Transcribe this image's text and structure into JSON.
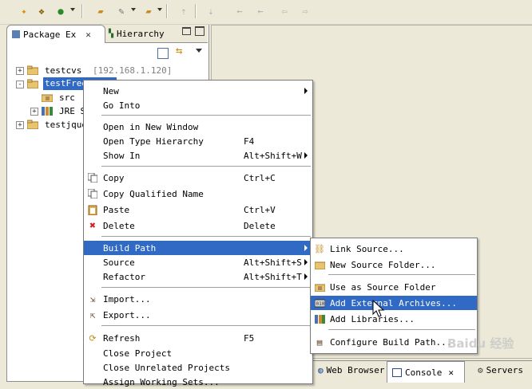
{
  "toolbar": {
    "icons": [
      "new-wizard-icon",
      "new-package-icon",
      "run-icon",
      "open-folder-icon",
      "build-tool-icon",
      "open-project-icon",
      "disabled-nav-icon",
      "disabled-nav-icon-2",
      "back-icon",
      "forward-icon",
      "back-history-icon",
      "forward-history-icon"
    ]
  },
  "package_explorer": {
    "tabs": [
      {
        "label": "Package Ex",
        "icon": "package-icon"
      },
      {
        "label": "Hierarchy",
        "icon": "hierarchy-icon"
      }
    ],
    "tree": [
      {
        "label": "testcvs",
        "extra": "[192.168.1.120]",
        "expander": "+"
      },
      {
        "label": "testFree",
        "expander": "-",
        "selected": true
      },
      {
        "label": "src"
      },
      {
        "label": "JRE S",
        "expander": "+"
      },
      {
        "label": "testjque",
        "expander": "+"
      }
    ]
  },
  "context_menu": {
    "items": [
      {
        "label": "New",
        "submenu": true
      },
      {
        "label": "Go Into"
      },
      {
        "label": "Open in New Window"
      },
      {
        "label": "Open Type Hierarchy",
        "shortcut": "F4"
      },
      {
        "label": "Show In",
        "shortcut": "Alt+Shift+W",
        "submenu": true
      },
      {
        "label": "Copy",
        "shortcut": "Ctrl+C"
      },
      {
        "label": "Copy Qualified Name"
      },
      {
        "label": "Paste",
        "shortcut": "Ctrl+V"
      },
      {
        "label": "Delete",
        "shortcut": "Delete"
      },
      {
        "label": "Build Path",
        "submenu": true,
        "selected": true
      },
      {
        "label": "Source",
        "shortcut": "Alt+Shift+S",
        "submenu": true
      },
      {
        "label": "Refactor",
        "shortcut": "Alt+Shift+T",
        "submenu": true
      },
      {
        "label": "Import..."
      },
      {
        "label": "Export..."
      },
      {
        "label": "Refresh",
        "shortcut": "F5"
      },
      {
        "label": "Close Project"
      },
      {
        "label": "Close Unrelated Projects"
      },
      {
        "label": "Assign Working Sets..."
      }
    ]
  },
  "build_path_submenu": {
    "items": [
      {
        "label": "Link Source..."
      },
      {
        "label": "New Source Folder..."
      },
      {
        "label": "Use as Source Folder"
      },
      {
        "label": "Add External Archives...",
        "selected": true
      },
      {
        "label": "Add Libraries..."
      },
      {
        "label": "Configure Build Path..."
      }
    ]
  },
  "bottom_tabs": [
    {
      "label": "Web Browser",
      "icon": "globe-icon"
    },
    {
      "label": "Console",
      "icon": "console-icon",
      "closable": true
    },
    {
      "label": "Servers",
      "icon": "servers-icon"
    }
  ],
  "watermark": "Baidu 经验",
  "colors": {
    "selection": "#316ac5",
    "background": "#ece9d8"
  }
}
